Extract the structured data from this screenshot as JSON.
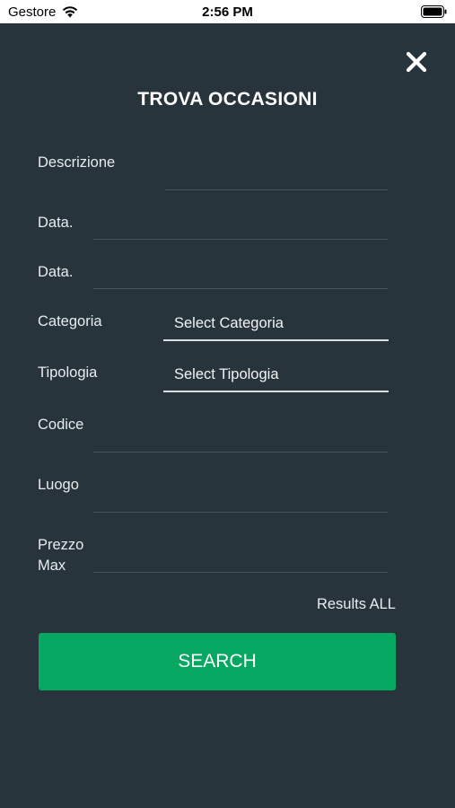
{
  "status_bar": {
    "carrier": "Gestore",
    "time": "2:56 PM"
  },
  "header": {
    "title": "TROVA OCCASIONI"
  },
  "form": {
    "descrizione_label": "Descrizione",
    "data_from_label": "Data.",
    "data_to_label": "Data.",
    "categoria_label": "Categoria",
    "categoria_value": "Select Categoria",
    "tipologia_label": "Tipologia",
    "tipologia_value": "Select Tipologia",
    "codice_label": "Codice",
    "luogo_label": "Luogo",
    "prezzo_label_line1": "Prezzo",
    "prezzo_label_line2": "Max"
  },
  "results_text": "Results ALL",
  "search_button_label": "SEARCH",
  "colors": {
    "background": "#27343c",
    "accent": "#06a861"
  },
  "icons": {
    "close": "close-icon",
    "wifi": "wifi-icon",
    "battery": "battery-icon"
  }
}
